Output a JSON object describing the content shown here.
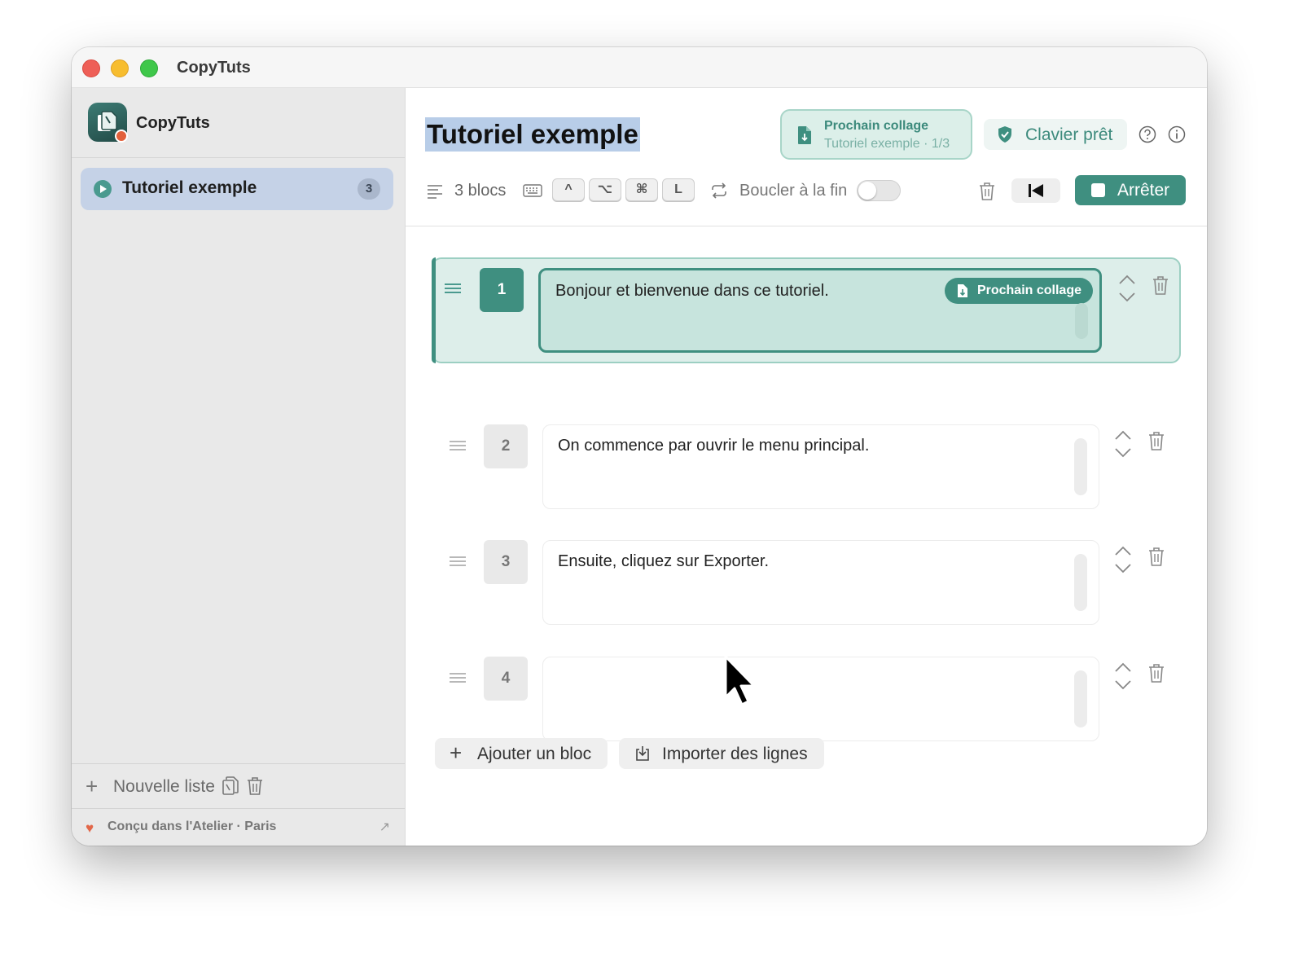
{
  "window": {
    "title": "CopyTuts"
  },
  "sidebar": {
    "app_name": "CopyTuts",
    "lists": [
      {
        "label": "Tutoriel exemple",
        "count": "3",
        "selected": true
      }
    ],
    "new_list_label": "Nouvelle liste",
    "credit": "Conçu dans l'Atelier · Paris",
    "icons": {
      "add": "plus-icon",
      "duplicate": "copy-icon",
      "delete": "trash-icon",
      "credit": "heart-icon",
      "external": "arrow-up-right-icon"
    }
  },
  "header": {
    "title": "Tutoriel exemple",
    "next_paste": {
      "label": "Prochain collage",
      "detail": "Tutoriel exemple · 1/3"
    },
    "keyboard_status": "Clavier prêt",
    "icons": [
      "help-icon",
      "info-icon"
    ]
  },
  "toolbar": {
    "blocks_count": "3 blocs",
    "shortcut_keys": [
      "^",
      "⌥",
      "⌘",
      "L"
    ],
    "loop_label": "Boucler à la fin",
    "loop_enabled": false,
    "stop_label": "Arrêter"
  },
  "blocks": [
    {
      "number": "1",
      "text": "Bonjour et bienvenue dans ce tutoriel.",
      "active": true,
      "badge": "Prochain collage"
    },
    {
      "number": "2",
      "text": "On commence par ouvrir le menu principal.",
      "active": false
    },
    {
      "number": "3",
      "text": "Ensuite, cliquez sur Exporter.",
      "active": false
    },
    {
      "number": "4",
      "text": "",
      "active": false
    }
  ],
  "actions": {
    "add_block": "Ajouter un bloc",
    "import_lines": "Importer des lignes"
  },
  "colors": {
    "accent": "#3f8f80",
    "accent_light": "#dcefe9",
    "selection": "#b8cde8",
    "sidebar_selected": "#c5d2e7"
  }
}
